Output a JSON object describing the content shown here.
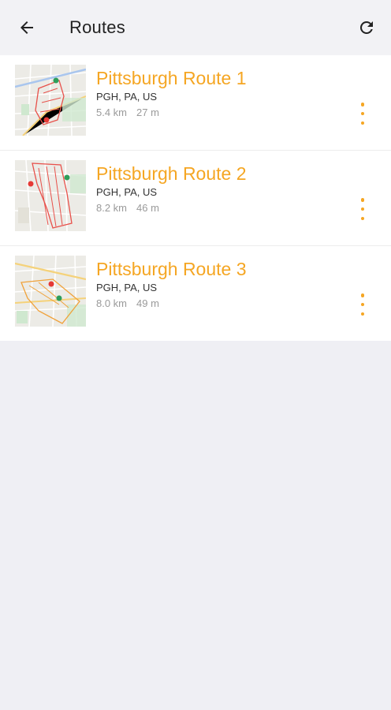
{
  "header": {
    "title": "Routes",
    "back_icon": "arrow-back-icon",
    "refresh_icon": "refresh-icon"
  },
  "colors": {
    "accent": "#f5a623",
    "background": "#efeff4",
    "route_line": "#e8504a",
    "pin_green": "#2e9e5b",
    "pin_red": "#e53935"
  },
  "routes": [
    {
      "name": "Pittsburgh Route 1",
      "location": "PGH, PA, US",
      "distance": "5.4 km",
      "duration": "27 m",
      "more_icon": "more-vertical-icon"
    },
    {
      "name": "Pittsburgh Route 2",
      "location": "PGH, PA, US",
      "distance": "8.2 km",
      "duration": "46 m",
      "more_icon": "more-vertical-icon"
    },
    {
      "name": "Pittsburgh Route 3",
      "location": "PGH, PA, US",
      "distance": "8.0 km",
      "duration": "49 m",
      "more_icon": "more-vertical-icon"
    }
  ]
}
